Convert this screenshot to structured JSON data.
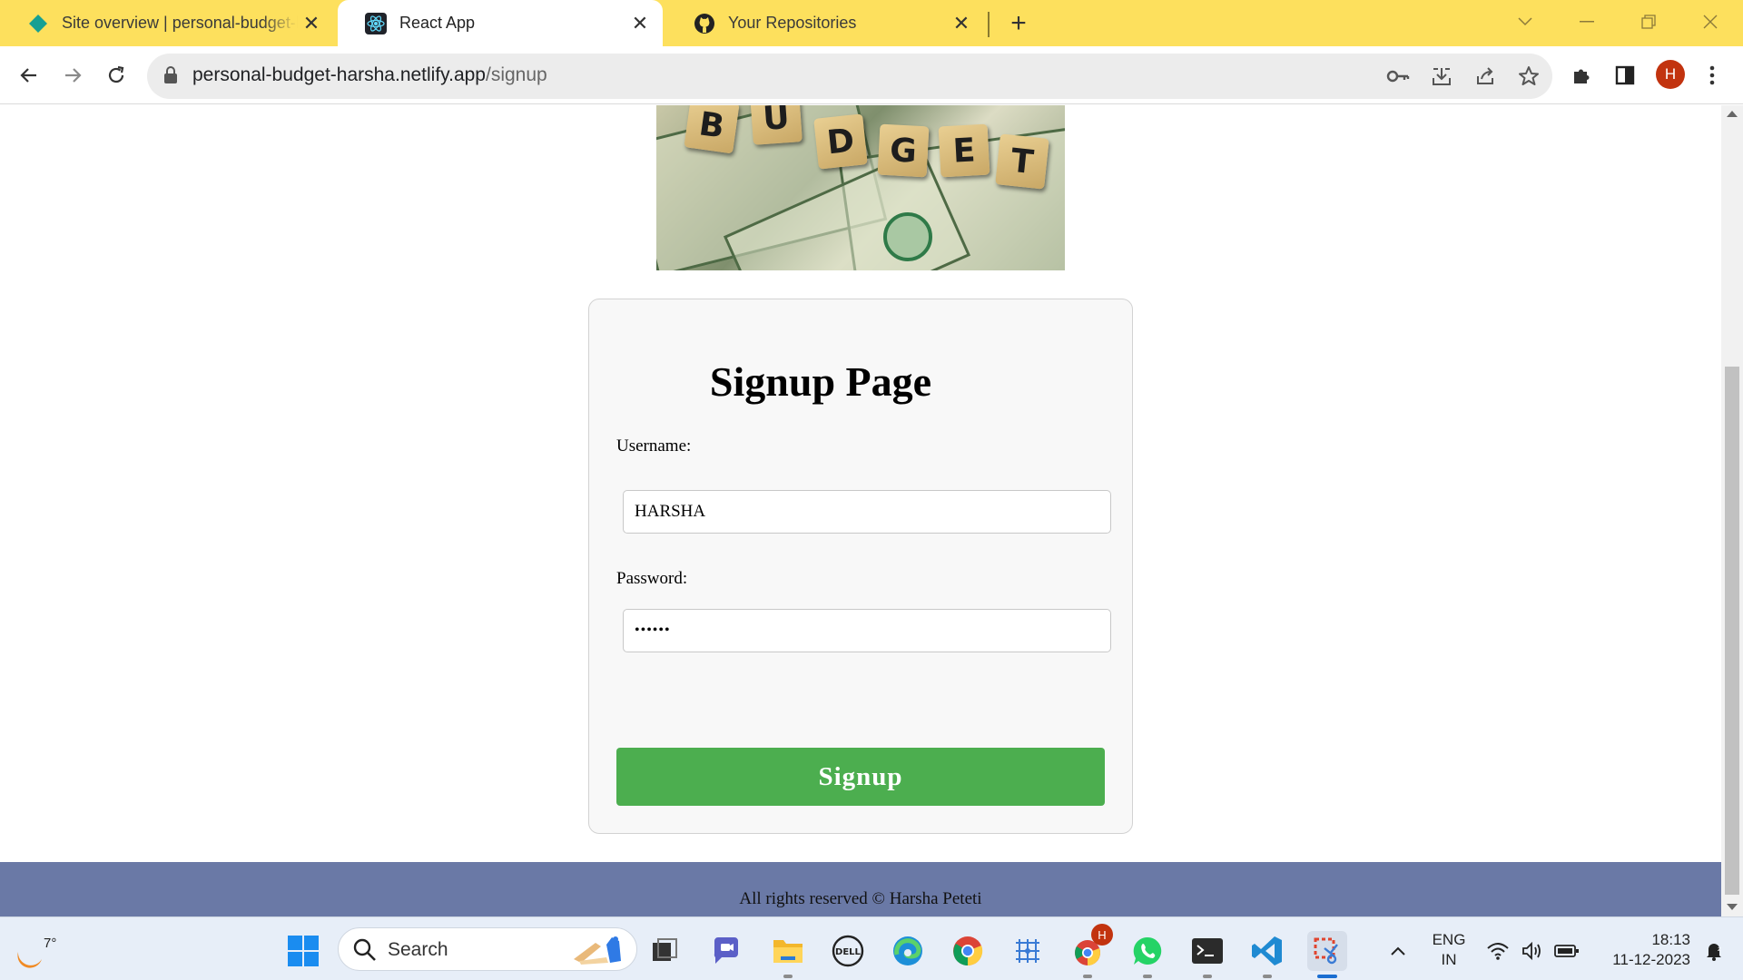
{
  "browser": {
    "tabs": [
      {
        "title": "Site overview | personal-budget-harsha",
        "favicon": "netlify-diamond-icon",
        "active": false
      },
      {
        "title": "React App",
        "favicon": "react-icon",
        "active": true
      },
      {
        "title": "Your Repositories",
        "favicon": "github-icon",
        "active": false
      }
    ],
    "url": {
      "host": "personal-budget-harsha.netlify.app",
      "path": "/signup"
    },
    "profile_initial": "H",
    "tab_strip_color": "#fde05d"
  },
  "page": {
    "banner_letters": [
      "B",
      "U",
      "D",
      "G",
      "E",
      "T"
    ],
    "signup": {
      "title": "Signup Page",
      "username_label": "Username:",
      "username_value": "HARSHA",
      "password_label": "Password:",
      "password_value": "••••••",
      "button_label": "Signup",
      "button_color": "#4cae4f"
    },
    "footer": {
      "text": "All rights reserved © Harsha Peteti",
      "color": "#6a79a6"
    }
  },
  "taskbar": {
    "weather_temp": "7°",
    "search_placeholder": "Search",
    "chrome_badge": "H",
    "tray": {
      "lang": "ENG",
      "region": "IN",
      "time": "18:13",
      "date": "11-12-2023"
    }
  }
}
